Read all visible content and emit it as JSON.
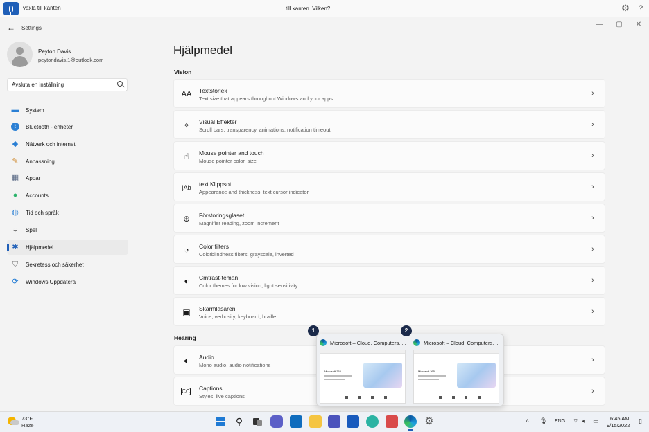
{
  "voice": {
    "command": "växla till kanten",
    "prompt": "till kanten. Vilken?"
  },
  "window": {
    "title": "Settings"
  },
  "profile": {
    "name": "Peyton Davis",
    "email": "peytondavis.1@outlook.com"
  },
  "search": {
    "value": "Avsluta en inställning"
  },
  "sidebar": {
    "items": [
      {
        "label": "System",
        "icon": "monitor-icon"
      },
      {
        "label": "Bluetooth - enheter",
        "icon": "bluetooth-icon"
      },
      {
        "label": "Nätverk och internet",
        "icon": "wifi-icon"
      },
      {
        "label": "Anpassning",
        "icon": "brush-icon"
      },
      {
        "label": "Appar",
        "icon": "apps-icon"
      },
      {
        "label": "Accounts",
        "icon": "person-icon"
      },
      {
        "label": "Tid och språk",
        "icon": "globe-clock-icon"
      },
      {
        "label": "Spel",
        "icon": "gamepad-icon"
      },
      {
        "label": "Hjälpmedel",
        "icon": "accessibility-icon"
      },
      {
        "label": "Sekretess och säkerhet",
        "icon": "shield-icon"
      },
      {
        "label": "Windows Uppdatera",
        "icon": "update-icon"
      }
    ],
    "active_index": 8
  },
  "main": {
    "title": "Hjälpmedel",
    "sections": [
      {
        "title": "Vision",
        "items": [
          {
            "title": "Textstorlek",
            "subtitle": "Text size that appears throughout Windows and your apps",
            "icon": "text-size-icon"
          },
          {
            "title": "Visual Effekter",
            "subtitle": "Scroll bars, transparency, animations, notification timeout",
            "icon": "sparkle-icon"
          },
          {
            "title": "Mouse pointer and touch",
            "subtitle": "Mouse pointer color, size",
            "icon": "pointer-icon"
          },
          {
            "title": "text Klippsot",
            "subtitle": "Appearance and thickness, text cursor indicator",
            "icon": "text-cursor-icon"
          },
          {
            "title": "Förstoringsglaset",
            "subtitle": "Magnifier reading, zoom increment",
            "icon": "magnifier-icon"
          },
          {
            "title": "Color filters",
            "subtitle": "Colorblindness filters, grayscale, inverted",
            "icon": "palette-icon"
          },
          {
            "title": "Cmtrast-teman",
            "subtitle": "Color themes for low vision, light sensitivity",
            "icon": "contrast-icon"
          },
          {
            "title": "Skärmläsaren",
            "subtitle": "Voice, verbosity, keyboard, braille",
            "icon": "narrator-icon"
          }
        ]
      },
      {
        "title": "Hearing",
        "items": [
          {
            "title": "Audio",
            "subtitle": "Mono audio, audio notifications",
            "icon": "speaker-icon"
          },
          {
            "title": "Captions",
            "subtitle": "Styles, live captions",
            "icon": "captions-icon"
          }
        ]
      }
    ]
  },
  "preview": {
    "windows": [
      {
        "badge": "1",
        "title": "Microsoft – Cloud, Computers, ...",
        "body_text": "Microsoft 365"
      },
      {
        "badge": "2",
        "title": "Microsoft – Cloud, Computers, ...",
        "body_text": "Microsoft 365"
      }
    ]
  },
  "taskbar": {
    "weather": {
      "temp": "73°F",
      "desc": "Haze"
    },
    "language": "ENG",
    "time": "6:45 AM",
    "date": "9/15/2022"
  },
  "colors": {
    "accent": "#1f5fb8"
  }
}
